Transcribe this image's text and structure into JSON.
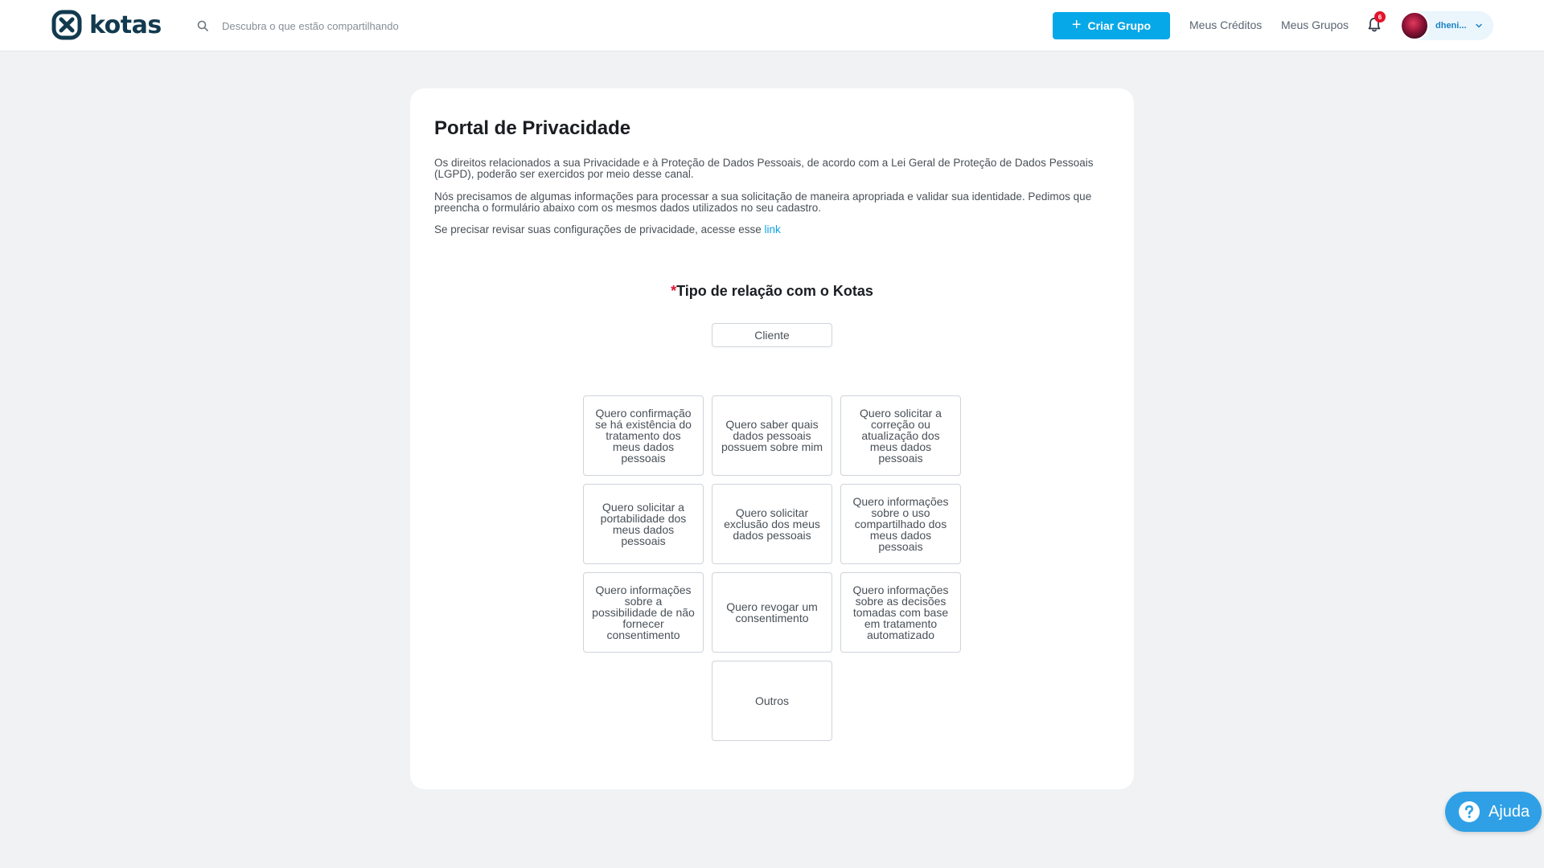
{
  "header": {
    "logo_text": "kotas",
    "search_placeholder": "Descubra o que estão compartilhando",
    "create_group_label": "Criar Grupo",
    "nav": {
      "credits": "Meus Créditos",
      "groups": "Meus Grupos"
    },
    "notifications_count": "6",
    "user_name": "dheni..."
  },
  "portal": {
    "title": "Portal de Privacidade",
    "paragraph1": "Os direitos relacionados a sua Privacidade e à Proteção de Dados Pessoais, de acordo com a Lei Geral de Proteção de Dados Pessoais (LGPD), poderão ser exercidos por meio desse canal.",
    "paragraph2": "Nós precisamos de algumas informações para processar a sua solicitação de maneira apropriada e validar sua identidade. Pedimos que preencha o formulário abaixo com os mesmos dados utilizados no seu cadastro.",
    "paragraph3_text": "Se precisar revisar suas configurações de privacidade, acesse esse ",
    "paragraph3_link": "link",
    "section_required": "*",
    "section_title": "Tipo de relação com o Kotas",
    "relation_selected": "Cliente",
    "options": [
      "Quero confirmação se há existência do tratamento dos meus dados pessoais",
      "Quero saber quais dados pessoais possuem sobre mim",
      "Quero solicitar a correção ou atualização dos meus dados pessoais",
      "Quero solicitar a portabilidade dos meus dados pessoais",
      "Quero solicitar exclusão dos meus dados pessoais",
      "Quero informações sobre o uso compartilhado dos meus dados pessoais",
      "Quero informações sobre a possibilidade de não fornecer consentimento",
      "Quero revogar um consentimento",
      "Quero informações sobre as decisões tomadas com base em tratamento automatizado",
      "Outros"
    ]
  },
  "help": {
    "label": "Ajuda"
  },
  "colors": {
    "brand_dark": "#123a4f",
    "accent": "#07a8e8",
    "badge": "#e3132b",
    "help": "#2fa0e6"
  }
}
